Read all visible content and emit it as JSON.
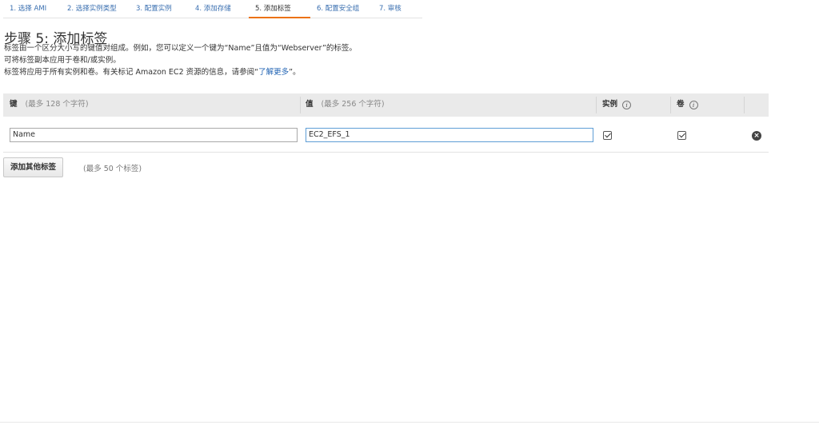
{
  "wizard": {
    "steps": [
      {
        "label": "1. 选择 AMI"
      },
      {
        "label": "2. 选择实例类型"
      },
      {
        "label": "3. 配置实例"
      },
      {
        "label": "4. 添加存储"
      },
      {
        "label": "5. 添加标签"
      },
      {
        "label": "6. 配置安全组"
      },
      {
        "label": "7. 审核"
      }
    ],
    "active_index": 4,
    "accent_color": "#ec7211"
  },
  "page": {
    "title": "步骤 5: 添加标签",
    "description_lines": [
      "标签由一个区分大小写的键值对组成。例如，您可以定义一个键为“Name”且值为“Webserver”的标签。",
      "可将标签副本应用于卷和/或实例。",
      "标签将应用于所有实例和卷。有关标记 Amazon EC2 资源的信息，请参阅“"
    ],
    "learn_more_link": "了解更多",
    "learn_more_suffix": "”。"
  },
  "table": {
    "headers": {
      "key": "键",
      "key_hint": "(最多 128 个字符)",
      "value": "值",
      "value_hint": "(最多 256 个字符)",
      "instances": "实例",
      "volumes": "卷"
    },
    "rows": [
      {
        "key": "Name",
        "value": "EC2_EFS_1",
        "instances": true,
        "volumes": true
      }
    ]
  },
  "actions": {
    "add_tag_label": "添加其他标签",
    "add_tag_note": "(最多 50 个标签)"
  }
}
